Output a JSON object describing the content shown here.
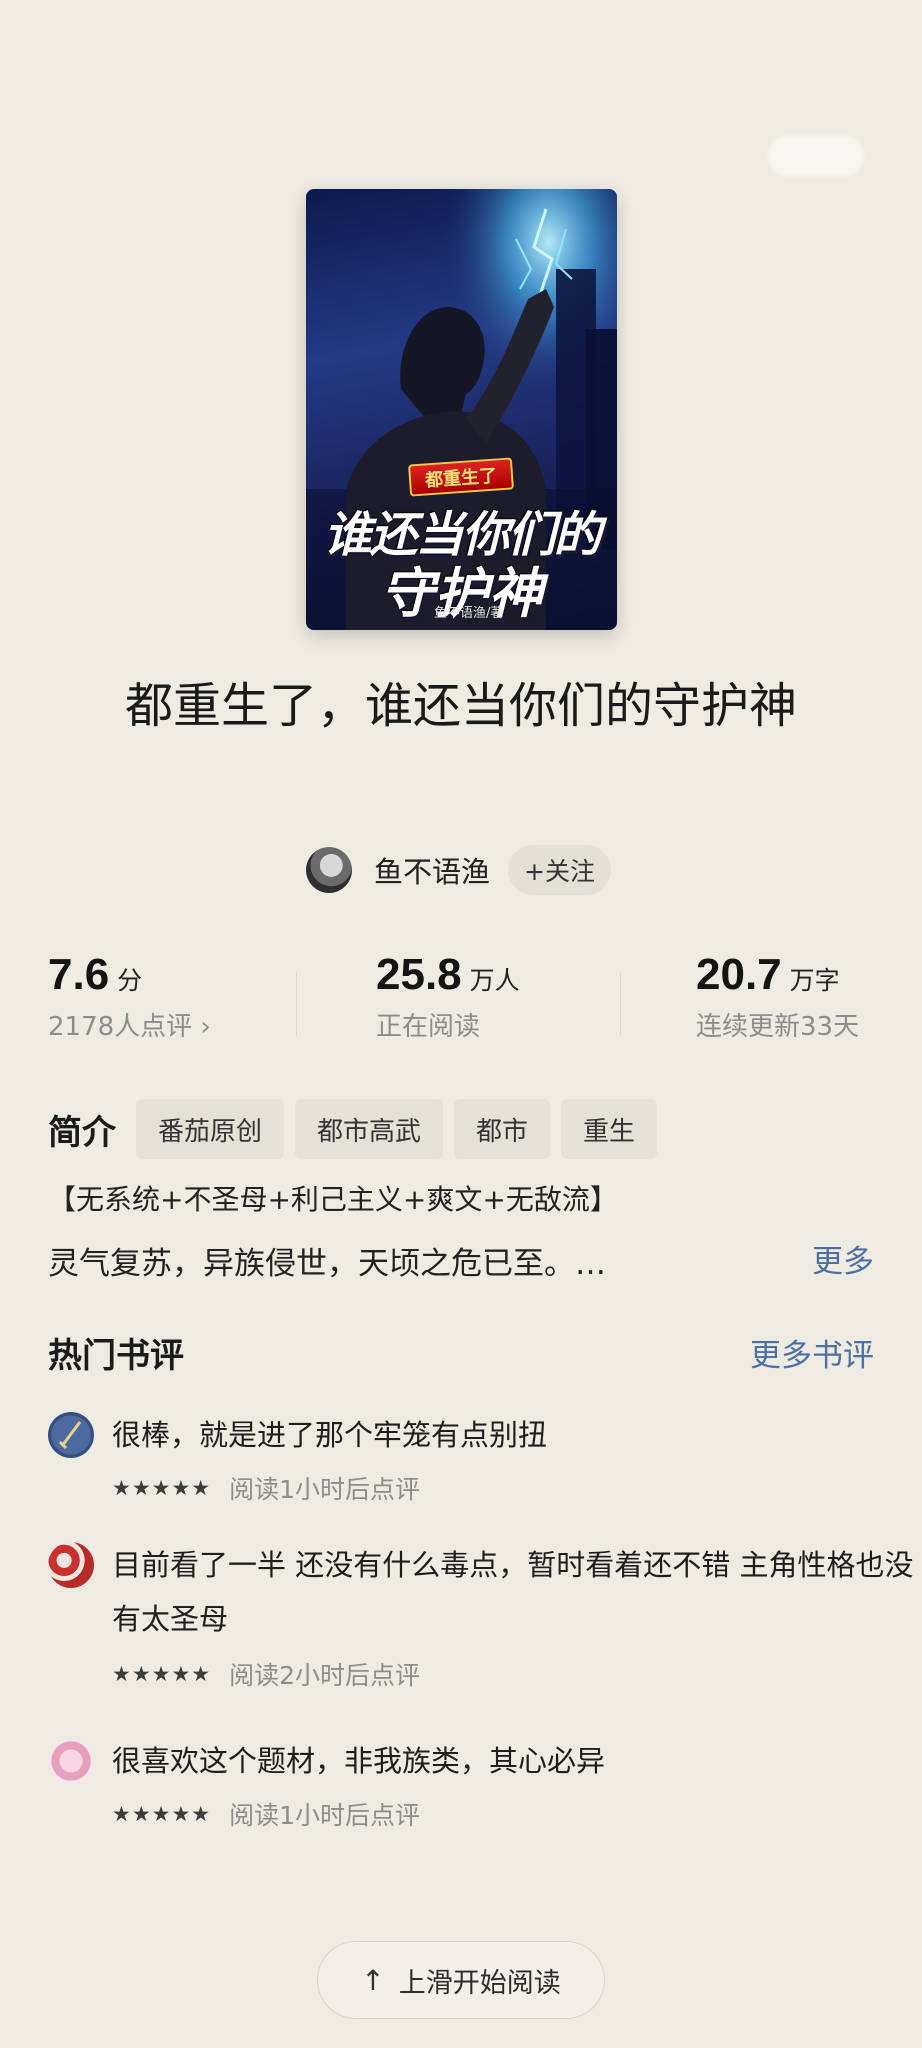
{
  "book": {
    "cover": {
      "small_title": "都重生了",
      "title_line1": "谁还当你们的",
      "title_line2": "守护神",
      "author_tag": "鱼不语渔/著"
    },
    "title": "都重生了，谁还当你们的守护神",
    "author": "鱼不语渔",
    "follow_label": "+关注"
  },
  "stats": {
    "rating": {
      "value": "7.6",
      "unit": "分",
      "sub": "2178人点评 ›"
    },
    "readers": {
      "value": "25.8",
      "unit": "万人",
      "sub": "正在阅读"
    },
    "words": {
      "value": "20.7",
      "unit": "万字",
      "sub": "连续更新33天"
    }
  },
  "intro": {
    "label": "简介",
    "tags": [
      "番茄原创",
      "都市高武",
      "都市",
      "重生"
    ],
    "line1": "【无系统+不圣母+利己主义+爽文+无敌流】",
    "line2": "灵气复苏，异族侵世，天顷之危已至。…",
    "more_label": "更多"
  },
  "hot_reviews": {
    "title": "热门书评",
    "more_label": "更多书评",
    "items": [
      {
        "text": "很棒，就是进了那个牢笼有点别扭",
        "stars": "★★★★★",
        "time": "阅读1小时后点评",
        "avatar_icon": "sword-avatar-icon"
      },
      {
        "text": "目前看了一半 还没有什么毒点，暂时看着还不错 主角性格也没有太圣母",
        "stars": "★★★★★",
        "time": "阅读2小时后点评",
        "avatar_icon": "red-pattern-avatar-icon"
      },
      {
        "text": "很喜欢这个题材，非我族类，其心必异",
        "stars": "★★★★★",
        "time": "阅读1小时后点评",
        "avatar_icon": "pink-flower-avatar-icon"
      }
    ]
  },
  "footer": {
    "swipe_label": "上滑开始阅读",
    "arrow_icon": "arrow-up-icon"
  },
  "colors": {
    "background": "#eeebe2",
    "link": "#4e6fa2",
    "tag_bg": "#e4e1d8"
  }
}
